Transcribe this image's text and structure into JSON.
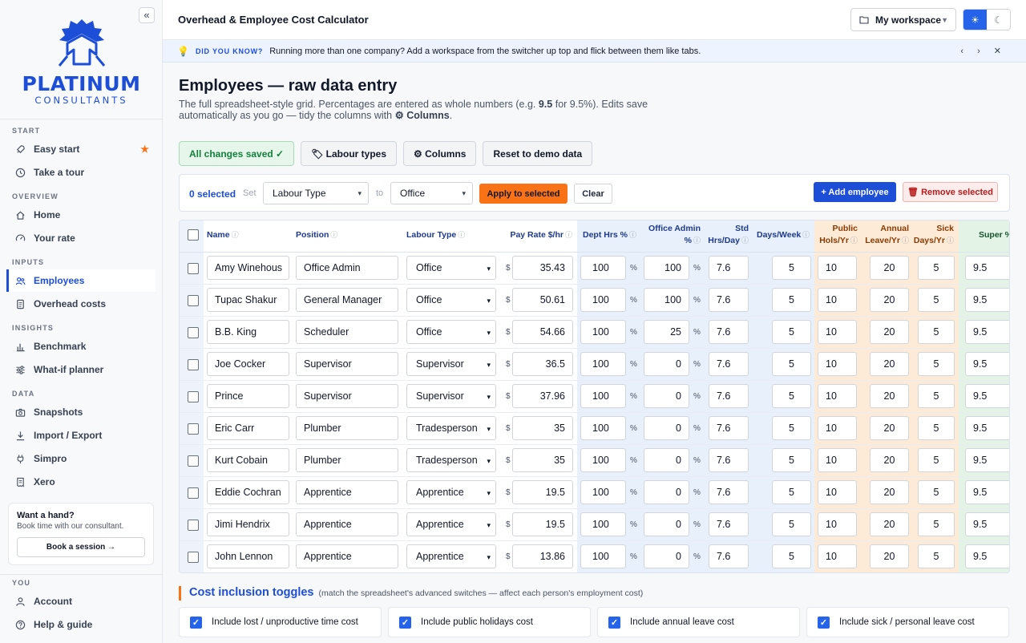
{
  "sidebar": {
    "collapse_label": "«",
    "logo": {
      "word": "PLATINUM",
      "sub": "CONSULTANTS"
    },
    "sections": {
      "start": "START",
      "overview": "OVERVIEW",
      "inputs": "INPUTS",
      "insights": "INSIGHTS",
      "data": "DATA",
      "you": "YOU"
    },
    "items": {
      "easy_start": "Easy start",
      "take_tour": "Take a tour",
      "home": "Home",
      "your_rate": "Your rate",
      "employees": "Employees",
      "overhead": "Overhead costs",
      "benchmark": "Benchmark",
      "whatif": "What-if planner",
      "snapshots": "Snapshots",
      "import_export": "Import / Export",
      "simpro": "Simpro",
      "xero": "Xero",
      "account": "Account",
      "help": "Help & guide"
    },
    "hand": {
      "title": "Want a hand?",
      "sub": "Book time with our consultant.",
      "button": "Book a session →"
    }
  },
  "header": {
    "title": "Overhead & Employee Cost Calculator",
    "workspace": "My workspace"
  },
  "tip": {
    "label": "DID YOU KNOW?",
    "text": "Running more than one company? Add a workspace from the switcher up top and flick between them like tabs.",
    "controls": "‹ › ✕"
  },
  "page": {
    "title": "Employees — raw data entry",
    "intro_1": "The full spreadsheet-style grid. Percentages are entered as whole numbers (e.g. ",
    "intro_bold_1": "9.5",
    "intro_2": " for 9.5%). Edits save automatically as you go — tidy the columns with ",
    "intro_bold_2": "⚙ Columns",
    "intro_3": "."
  },
  "actions": {
    "saved": "All changes saved ✓",
    "labour_types": "🏷 Labour types",
    "columns": "⚙ Columns",
    "reset": "Reset to demo data"
  },
  "selection": {
    "count": "0 selected",
    "set": "Set",
    "field": "Labour Type",
    "to": "to",
    "value": "Office",
    "apply": "Apply to selected",
    "clear": "Clear",
    "add": "+ Add employee",
    "remove": "🗑 Remove selected"
  },
  "columns": {
    "name": "Name",
    "position": "Position",
    "labour_type": "Labour Type",
    "pay_rate": "Pay Rate $/hr",
    "dept_hrs": "Dept Hrs %",
    "office_admin_1": "Office Admin",
    "office_admin_2": "%",
    "std_hrs_1": "Std",
    "std_hrs_2": "Hrs/Day",
    "days_week": "Days/Week",
    "public_hols_1": "Public",
    "public_hols_2": "Hols/Yr",
    "annual_leave_1": "Annual",
    "annual_leave_2": "Leave/Yr",
    "sick_1": "Sick",
    "sick_2": "Days/Yr",
    "super": "Super %",
    "info": "ⓘ"
  },
  "units": {
    "currency": "$",
    "percent": "%"
  },
  "employees": [
    {
      "name": "Amy Winehous",
      "position": "Office Admin",
      "labour": "Office",
      "rate": "35.43",
      "dept": "100",
      "admin": "100",
      "std": "7.6",
      "days": "5",
      "hols": "10",
      "annual": "20",
      "sick": "5",
      "super": "9.5"
    },
    {
      "name": "Tupac Shakur",
      "position": "General Manager",
      "labour": "Office",
      "rate": "50.61",
      "dept": "100",
      "admin": "100",
      "std": "7.6",
      "days": "5",
      "hols": "10",
      "annual": "20",
      "sick": "5",
      "super": "9.5"
    },
    {
      "name": "B.B. King",
      "position": "Scheduler",
      "labour": "Office",
      "rate": "54.66",
      "dept": "100",
      "admin": "25",
      "std": "7.6",
      "days": "5",
      "hols": "10",
      "annual": "20",
      "sick": "5",
      "super": "9.5"
    },
    {
      "name": "Joe Cocker",
      "position": "Supervisor",
      "labour": "Supervisor",
      "rate": "36.5",
      "dept": "100",
      "admin": "0",
      "std": "7.6",
      "days": "5",
      "hols": "10",
      "annual": "20",
      "sick": "5",
      "super": "9.5"
    },
    {
      "name": "Prince",
      "position": "Supervisor",
      "labour": "Supervisor",
      "rate": "37.96",
      "dept": "100",
      "admin": "0",
      "std": "7.6",
      "days": "5",
      "hols": "10",
      "annual": "20",
      "sick": "5",
      "super": "9.5"
    },
    {
      "name": "Eric Carr",
      "position": "Plumber",
      "labour": "Tradesperson",
      "rate": "35",
      "dept": "100",
      "admin": "0",
      "std": "7.6",
      "days": "5",
      "hols": "10",
      "annual": "20",
      "sick": "5",
      "super": "9.5"
    },
    {
      "name": "Kurt Cobain",
      "position": "Plumber",
      "labour": "Tradesperson",
      "rate": "35",
      "dept": "100",
      "admin": "0",
      "std": "7.6",
      "days": "5",
      "hols": "10",
      "annual": "20",
      "sick": "5",
      "super": "9.5"
    },
    {
      "name": "Eddie Cochran",
      "position": "Apprentice",
      "labour": "Apprentice",
      "rate": "19.5",
      "dept": "100",
      "admin": "0",
      "std": "7.6",
      "days": "5",
      "hols": "10",
      "annual": "20",
      "sick": "5",
      "super": "9.5"
    },
    {
      "name": "Jimi Hendrix",
      "position": "Apprentice",
      "labour": "Apprentice",
      "rate": "19.5",
      "dept": "100",
      "admin": "0",
      "std": "7.6",
      "days": "5",
      "hols": "10",
      "annual": "20",
      "sick": "5",
      "super": "9.5"
    },
    {
      "name": "John Lennon",
      "position": "Apprentice",
      "labour": "Apprentice",
      "rate": "13.86",
      "dept": "100",
      "admin": "0",
      "std": "7.6",
      "days": "5",
      "hols": "10",
      "annual": "20",
      "sick": "5",
      "super": "9.5"
    }
  ],
  "toggles": {
    "title": "Cost inclusion toggles",
    "subtitle": "(match the spreadsheet's advanced switches — affect each person's employment cost)",
    "items": [
      "Include lost / unproductive time cost",
      "Include public holidays cost",
      "Include annual leave cost",
      "Include sick / personal leave cost"
    ]
  },
  "colors": {
    "accent": "#1d4ed8",
    "orange": "#f97316",
    "saved_green": "#15803d"
  },
  "icons": [
    "collapse-icon",
    "logo-gear-icon",
    "rocket-icon",
    "clock-icon",
    "home-icon",
    "gauge-icon",
    "users-icon",
    "doc-icon",
    "bar-chart-icon",
    "sliders-icon",
    "camera-icon",
    "download-icon",
    "plug-icon",
    "receipt-icon",
    "user-icon",
    "help-icon",
    "star-icon",
    "bulb-icon",
    "folder-icon",
    "sun-icon",
    "moon-icon",
    "chevron-down-icon",
    "info-icon"
  ]
}
